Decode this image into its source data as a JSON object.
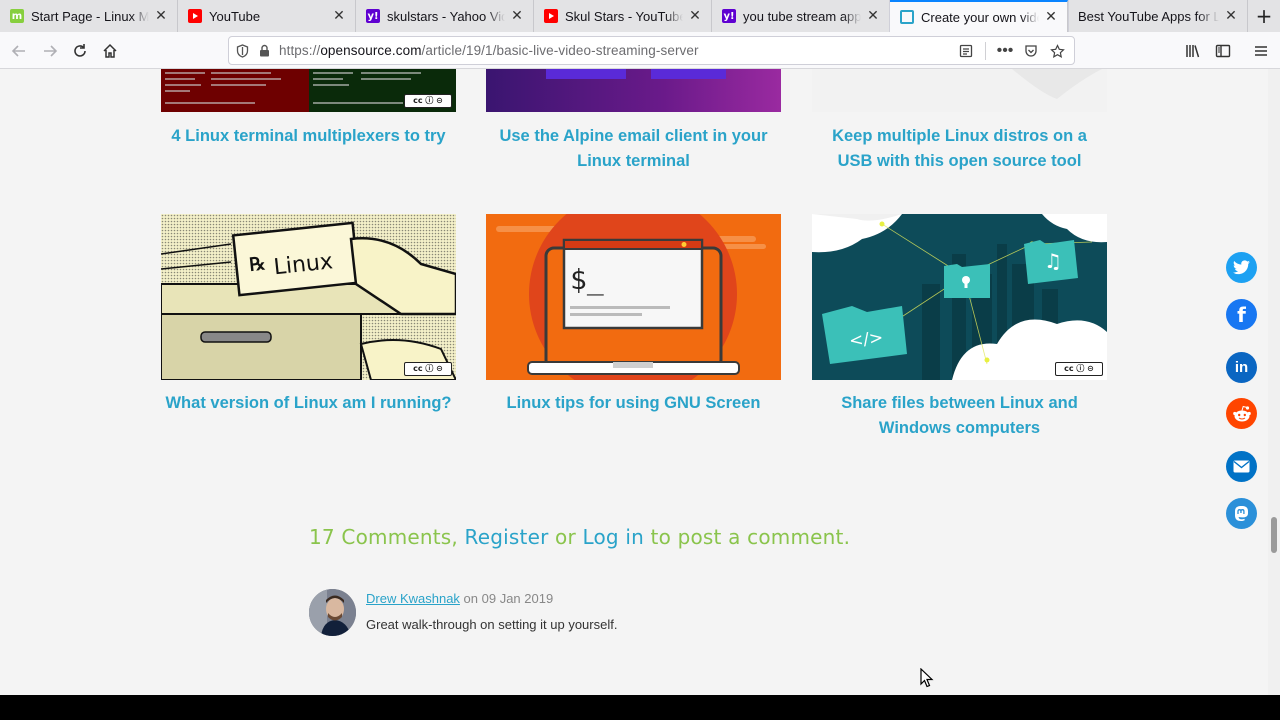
{
  "browser": {
    "tabs": [
      {
        "title": "Start Page - Linux Mint",
        "icon": "mint-icon",
        "active": false
      },
      {
        "title": "YouTube",
        "icon": "youtube-icon",
        "active": false
      },
      {
        "title": "skulstars - Yahoo Video Search",
        "icon": "yahoo-icon",
        "active": false
      },
      {
        "title": "Skul Stars - YouTube",
        "icon": "youtube-icon",
        "active": false
      },
      {
        "title": "you tube stream apps",
        "icon": "yahoo-icon",
        "active": false
      },
      {
        "title": "Create your own video",
        "icon": "opensource-icon",
        "active": true
      },
      {
        "title": "Best YouTube Apps for Linux",
        "icon": "none",
        "active": false
      }
    ],
    "url_host": "opensource.com",
    "url_prefix": "https://",
    "url_path": "/article/19/1/basic-live-video-streaming-server"
  },
  "articles_row1": [
    {
      "title_line1": "4 Linux terminal multiplexers to try",
      "title_line2": ""
    },
    {
      "title_line1": "Use the Alpine email client in your",
      "title_line2": "Linux terminal"
    },
    {
      "title_line1": "Keep multiple Linux distros on a",
      "title_line2": "USB with this open source tool"
    }
  ],
  "articles_row2": [
    {
      "title_line1": "What version of Linux am I running?",
      "title_line2": "",
      "image_text": "Linux"
    },
    {
      "title_line1": "Linux tips for using GNU Screen",
      "title_line2": "",
      "image_text": "$_"
    },
    {
      "title_line1": "Share files between Linux and",
      "title_line2": "Windows computers",
      "image_text": "</>"
    }
  ],
  "comments_section": {
    "count_text": "17 Comments",
    "sep1": ", ",
    "register_text": "Register",
    "or_text": " or ",
    "login_text": "Log in",
    "suffix_text": " to post a comment."
  },
  "comment": {
    "author": "Drew Kwashnak",
    "on_text": " on ",
    "date": "09 Jan 2019",
    "body": "Great walk-through on setting it up yourself."
  },
  "share_icons": [
    "twitter-icon",
    "facebook-icon",
    "linkedin-icon",
    "reddit-icon",
    "email-icon",
    "mastodon-icon"
  ],
  "colors": {
    "link": "#2aa3c9",
    "accent_green": "#8ac44c",
    "twitter": "#1da1f2",
    "facebook": "#1877f2",
    "linkedin": "#0a66c2",
    "reddit": "#ff4500",
    "email": "#0072c6",
    "mastodon": "#2b90d9"
  }
}
